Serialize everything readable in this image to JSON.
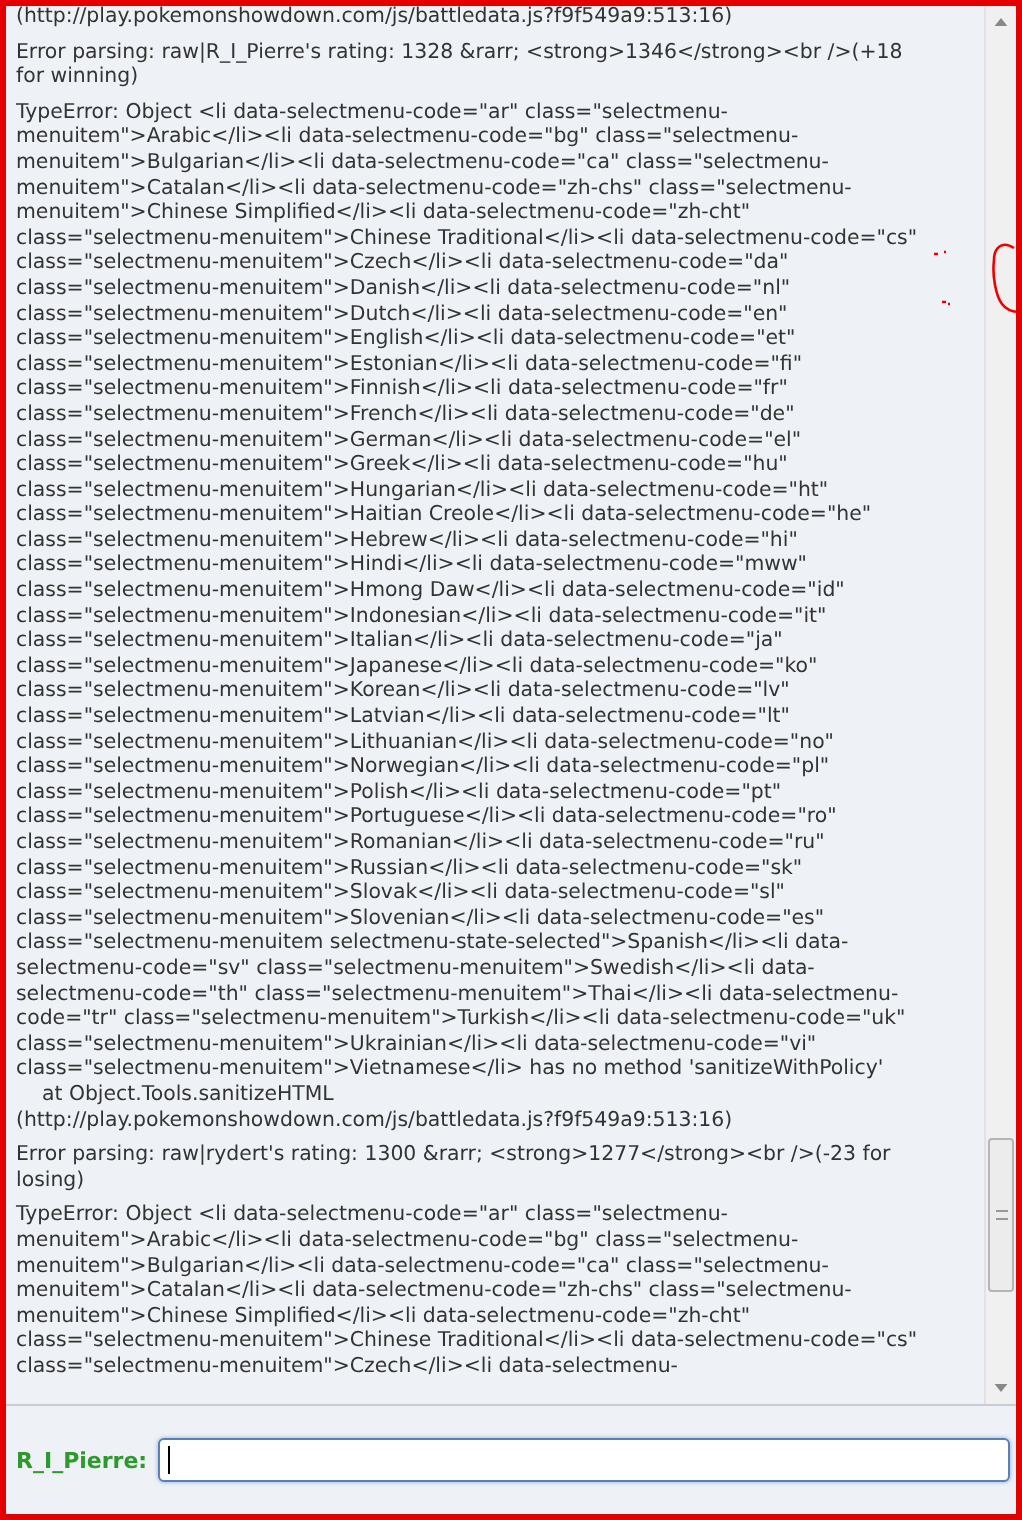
{
  "log": [
    "(http://play.pokemonshowdown.com/js/battledata.js?f9f549a9:513:16)",
    "Error parsing: raw|R_I_Pierre's rating: 1328 &rarr; <strong>1346</strong><br />(+18 for winning)",
    "TypeError: Object <li data-selectmenu-code=\"ar\" class=\"selectmenu-menuitem\">Arabic</li><li data-selectmenu-code=\"bg\" class=\"selectmenu-menuitem\">Bulgarian</li><li data-selectmenu-code=\"ca\" class=\"selectmenu-menuitem\">Catalan</li><li data-selectmenu-code=\"zh-chs\" class=\"selectmenu-menuitem\">Chinese Simplified</li><li data-selectmenu-code=\"zh-cht\" class=\"selectmenu-menuitem\">Chinese Traditional</li><li data-selectmenu-code=\"cs\" class=\"selectmenu-menuitem\">Czech</li><li data-selectmenu-code=\"da\" class=\"selectmenu-menuitem\">Danish</li><li data-selectmenu-code=\"nl\" class=\"selectmenu-menuitem\">Dutch</li><li data-selectmenu-code=\"en\" class=\"selectmenu-menuitem\">English</li><li data-selectmenu-code=\"et\" class=\"selectmenu-menuitem\">Estonian</li><li data-selectmenu-code=\"fi\" class=\"selectmenu-menuitem\">Finnish</li><li data-selectmenu-code=\"fr\" class=\"selectmenu-menuitem\">French</li><li data-selectmenu-code=\"de\" class=\"selectmenu-menuitem\">German</li><li data-selectmenu-code=\"el\" class=\"selectmenu-menuitem\">Greek</li><li data-selectmenu-code=\"hu\" class=\"selectmenu-menuitem\">Hungarian</li><li data-selectmenu-code=\"ht\" class=\"selectmenu-menuitem\">Haitian Creole</li><li data-selectmenu-code=\"he\" class=\"selectmenu-menuitem\">Hebrew</li><li data-selectmenu-code=\"hi\" class=\"selectmenu-menuitem\">Hindi</li><li data-selectmenu-code=\"mww\" class=\"selectmenu-menuitem\">Hmong Daw</li><li data-selectmenu-code=\"id\" class=\"selectmenu-menuitem\">Indonesian</li><li data-selectmenu-code=\"it\" class=\"selectmenu-menuitem\">Italian</li><li data-selectmenu-code=\"ja\" class=\"selectmenu-menuitem\">Japanese</li><li data-selectmenu-code=\"ko\" class=\"selectmenu-menuitem\">Korean</li><li data-selectmenu-code=\"lv\" class=\"selectmenu-menuitem\">Latvian</li><li data-selectmenu-code=\"lt\" class=\"selectmenu-menuitem\">Lithuanian</li><li data-selectmenu-code=\"no\" class=\"selectmenu-menuitem\">Norwegian</li><li data-selectmenu-code=\"pl\" class=\"selectmenu-menuitem\">Polish</li><li data-selectmenu-code=\"pt\" class=\"selectmenu-menuitem\">Portuguese</li><li data-selectmenu-code=\"ro\" class=\"selectmenu-menuitem\">Romanian</li><li data-selectmenu-code=\"ru\" class=\"selectmenu-menuitem\">Russian</li><li data-selectmenu-code=\"sk\" class=\"selectmenu-menuitem\">Slovak</li><li data-selectmenu-code=\"sl\" class=\"selectmenu-menuitem\">Slovenian</li><li data-selectmenu-code=\"es\" class=\"selectmenu-menuitem selectmenu-state-selected\">Spanish</li><li data-selectmenu-code=\"sv\" class=\"selectmenu-menuitem\">Swedish</li><li data-selectmenu-code=\"th\" class=\"selectmenu-menuitem\">Thai</li><li data-selectmenu-code=\"tr\" class=\"selectmenu-menuitem\">Turkish</li><li data-selectmenu-code=\"uk\" class=\"selectmenu-menuitem\">Ukrainian</li><li data-selectmenu-code=\"vi\" class=\"selectmenu-menuitem\">Vietnamese</li> has no method 'sanitizeWithPolicy'\n    at Object.Tools.sanitizeHTML\n(http://play.pokemonshowdown.com/js/battledata.js?f9f549a9:513:16)",
    "Error parsing: raw|rydert's rating: 1300 &rarr; <strong>1277</strong><br />(-23 for losing)",
    "TypeError: Object <li data-selectmenu-code=\"ar\" class=\"selectmenu-menuitem\">Arabic</li><li data-selectmenu-code=\"bg\" class=\"selectmenu-menuitem\">Bulgarian</li><li data-selectmenu-code=\"ca\" class=\"selectmenu-menuitem\">Catalan</li><li data-selectmenu-code=\"zh-chs\" class=\"selectmenu-menuitem\">Chinese Simplified</li><li data-selectmenu-code=\"zh-cht\" class=\"selectmenu-menuitem\">Chinese Traditional</li><li data-selectmenu-code=\"cs\" class=\"selectmenu-menuitem\">Czech</li><li data-selectmenu-"
  ],
  "chat": {
    "label": "R_I_Pierre:",
    "focused": true
  }
}
